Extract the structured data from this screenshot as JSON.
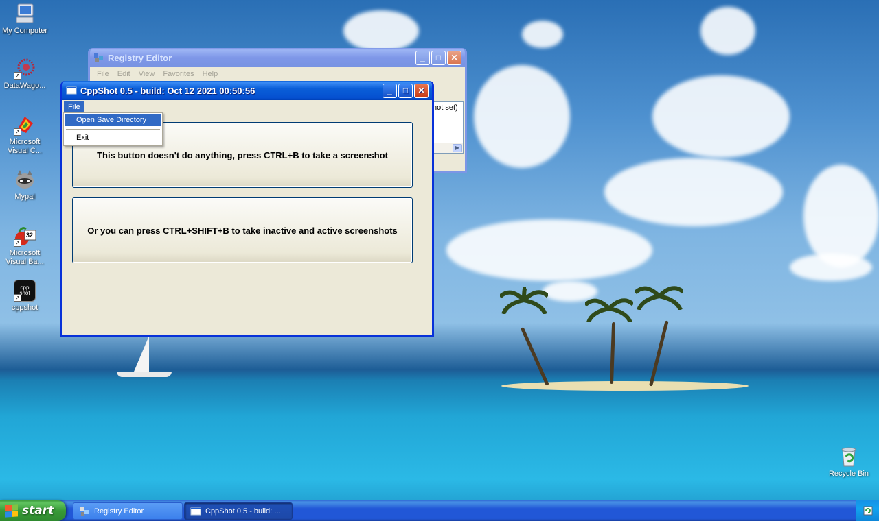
{
  "desktop": {
    "icons": [
      {
        "label": "My Computer",
        "icon": "my-computer-icon"
      },
      {
        "label": "DataWago...",
        "icon": "datawago-icon"
      },
      {
        "label": "Microsoft Visual C...",
        "icon": "visual-c-icon"
      },
      {
        "label": "Mypal",
        "icon": "mypal-raccoon-icon"
      },
      {
        "label": "Microsoft Visual Ba...",
        "icon": "visual-basic-icon"
      },
      {
        "label": "cppshot",
        "icon": "cppshot-icon"
      },
      {
        "label": "Recycle Bin",
        "icon": "recycle-bin-icon"
      }
    ],
    "cppshot_icon_text": "cpp shot",
    "vb_badge": "32"
  },
  "registry_window": {
    "title": "Registry Editor",
    "menu": [
      "File",
      "Edit",
      "View",
      "Favorites",
      "Help"
    ],
    "visible_value": "not set)",
    "active": false
  },
  "cppshot_window": {
    "title": "CppShot 0.5 - build: Oct 12 2021 00:50:56",
    "menu": [
      "File"
    ],
    "button1_label": "This button doesn't do anything, press CTRL+B to take a screenshot",
    "button2_label": "Or you can press CTRL+SHIFT+B to take inactive and active screenshots",
    "active": true
  },
  "file_menu": {
    "items": [
      {
        "label": "Open Save Directory",
        "highlighted": true
      },
      {
        "label": "Exit",
        "highlighted": false
      }
    ]
  },
  "taskbar": {
    "start_label": "start",
    "tasks": [
      {
        "label": "Registry Editor",
        "active": false
      },
      {
        "label": "CppShot 0.5 - build: ...",
        "active": true
      }
    ],
    "tray_icon": "recycle-tray-icon"
  },
  "colors": {
    "xp_blue": "#0a5fd8",
    "menu_highlight": "#316ac5",
    "window_face": "#ece9d8",
    "start_green": "#3c9a3c"
  }
}
